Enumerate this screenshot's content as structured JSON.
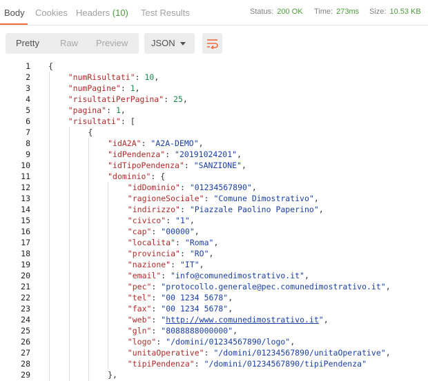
{
  "tabs": [
    {
      "label": "Body"
    },
    {
      "label": "Cookies"
    },
    {
      "label": "Headers",
      "count": "(10)"
    },
    {
      "label": "Test Results"
    }
  ],
  "response": {
    "status_label": "Status:",
    "status_value": "200 OK",
    "time_label": "Time:",
    "time_value": "273ms",
    "size_label": "Size:",
    "size_value": "10.53 KB"
  },
  "toolbar": {
    "views": [
      "Pretty",
      "Raw",
      "Preview"
    ],
    "format": "JSON",
    "wrap_icon": "wrap-lines-icon"
  },
  "colors": {
    "accent": "#f26b3a",
    "ok": "#4c9a3a",
    "key": "#b22a2a",
    "string": "#1a3ea8",
    "number": "#148b4a"
  },
  "code_lines": [
    {
      "n": "1",
      "indent": 0,
      "parts": [
        [
          "p",
          "{"
        ]
      ]
    },
    {
      "n": "2",
      "indent": 1,
      "parts": [
        [
          "k",
          "\"numRisultati\""
        ],
        [
          "p",
          ": "
        ],
        [
          "n",
          "10"
        ],
        [
          "p",
          ","
        ]
      ]
    },
    {
      "n": "3",
      "indent": 1,
      "parts": [
        [
          "k",
          "\"numPagine\""
        ],
        [
          "p",
          ": "
        ],
        [
          "n",
          "1"
        ],
        [
          "p",
          ","
        ]
      ]
    },
    {
      "n": "4",
      "indent": 1,
      "parts": [
        [
          "k",
          "\"risultatiPerPagina\""
        ],
        [
          "p",
          ": "
        ],
        [
          "n",
          "25"
        ],
        [
          "p",
          ","
        ]
      ]
    },
    {
      "n": "5",
      "indent": 1,
      "parts": [
        [
          "k",
          "\"pagina\""
        ],
        [
          "p",
          ": "
        ],
        [
          "n",
          "1"
        ],
        [
          "p",
          ","
        ]
      ]
    },
    {
      "n": "6",
      "indent": 1,
      "parts": [
        [
          "k",
          "\"risultati\""
        ],
        [
          "p",
          ": ["
        ]
      ]
    },
    {
      "n": "7",
      "indent": 2,
      "parts": [
        [
          "p",
          "{"
        ]
      ]
    },
    {
      "n": "8",
      "indent": 3,
      "parts": [
        [
          "k",
          "\"idA2A\""
        ],
        [
          "p",
          ": "
        ],
        [
          "s",
          "\"A2A-DEMO\""
        ],
        [
          "p",
          ","
        ]
      ]
    },
    {
      "n": "9",
      "indent": 3,
      "parts": [
        [
          "k",
          "\"idPendenza\""
        ],
        [
          "p",
          ": "
        ],
        [
          "s",
          "\"20191024201\""
        ],
        [
          "p",
          ","
        ]
      ]
    },
    {
      "n": "10",
      "indent": 3,
      "parts": [
        [
          "k",
          "\"idTipoPendenza\""
        ],
        [
          "p",
          ": "
        ],
        [
          "s",
          "\"SANZIONE\""
        ],
        [
          "p",
          ","
        ]
      ]
    },
    {
      "n": "11",
      "indent": 3,
      "parts": [
        [
          "k",
          "\"dominio\""
        ],
        [
          "p",
          ": {"
        ]
      ]
    },
    {
      "n": "12",
      "indent": 4,
      "parts": [
        [
          "k",
          "\"idDominio\""
        ],
        [
          "p",
          ": "
        ],
        [
          "s",
          "\"01234567890\""
        ],
        [
          "p",
          ","
        ]
      ]
    },
    {
      "n": "13",
      "indent": 4,
      "parts": [
        [
          "k",
          "\"ragioneSociale\""
        ],
        [
          "p",
          ": "
        ],
        [
          "s",
          "\"Comune Dimostrativo\""
        ],
        [
          "p",
          ","
        ]
      ]
    },
    {
      "n": "14",
      "indent": 4,
      "parts": [
        [
          "k",
          "\"indirizzo\""
        ],
        [
          "p",
          ": "
        ],
        [
          "s",
          "\"Piazzale Paolino Paperino\""
        ],
        [
          "p",
          ","
        ]
      ]
    },
    {
      "n": "15",
      "indent": 4,
      "parts": [
        [
          "k",
          "\"civico\""
        ],
        [
          "p",
          ": "
        ],
        [
          "s",
          "\"1\""
        ],
        [
          "p",
          ","
        ]
      ]
    },
    {
      "n": "16",
      "indent": 4,
      "parts": [
        [
          "k",
          "\"cap\""
        ],
        [
          "p",
          ": "
        ],
        [
          "s",
          "\"00000\""
        ],
        [
          "p",
          ","
        ]
      ]
    },
    {
      "n": "17",
      "indent": 4,
      "parts": [
        [
          "k",
          "\"localita\""
        ],
        [
          "p",
          ": "
        ],
        [
          "s",
          "\"Roma\""
        ],
        [
          "p",
          ","
        ]
      ]
    },
    {
      "n": "18",
      "indent": 4,
      "parts": [
        [
          "k",
          "\"provincia\""
        ],
        [
          "p",
          ": "
        ],
        [
          "s",
          "\"RO\""
        ],
        [
          "p",
          ","
        ]
      ]
    },
    {
      "n": "19",
      "indent": 4,
      "parts": [
        [
          "k",
          "\"nazione\""
        ],
        [
          "p",
          ": "
        ],
        [
          "s",
          "\"IT\""
        ],
        [
          "p",
          ","
        ]
      ]
    },
    {
      "n": "20",
      "indent": 4,
      "parts": [
        [
          "k",
          "\"email\""
        ],
        [
          "p",
          ": "
        ],
        [
          "s",
          "\"info@comunedimostrativo.it\""
        ],
        [
          "p",
          ","
        ]
      ]
    },
    {
      "n": "21",
      "indent": 4,
      "parts": [
        [
          "k",
          "\"pec\""
        ],
        [
          "p",
          ": "
        ],
        [
          "s",
          "\"protocollo.generale@pec.comunedimostrativo.it\""
        ],
        [
          "p",
          ","
        ]
      ]
    },
    {
      "n": "22",
      "indent": 4,
      "parts": [
        [
          "k",
          "\"tel\""
        ],
        [
          "p",
          ": "
        ],
        [
          "s",
          "\"00 1234 5678\""
        ],
        [
          "p",
          ","
        ]
      ]
    },
    {
      "n": "23",
      "indent": 4,
      "parts": [
        [
          "k",
          "\"fax\""
        ],
        [
          "p",
          ": "
        ],
        [
          "s",
          "\"00 1234 5678\""
        ],
        [
          "p",
          ","
        ]
      ]
    },
    {
      "n": "24",
      "indent": 4,
      "parts": [
        [
          "k",
          "\"web\""
        ],
        [
          "p",
          ": "
        ],
        [
          "s",
          "\""
        ],
        [
          "u",
          "http://www.comunedimostrativo.it"
        ],
        [
          "s",
          "\""
        ],
        [
          "p",
          ","
        ]
      ]
    },
    {
      "n": "25",
      "indent": 4,
      "parts": [
        [
          "k",
          "\"gln\""
        ],
        [
          "p",
          ": "
        ],
        [
          "s",
          "\"8088888000000\""
        ],
        [
          "p",
          ","
        ]
      ]
    },
    {
      "n": "26",
      "indent": 4,
      "parts": [
        [
          "k",
          "\"logo\""
        ],
        [
          "p",
          ": "
        ],
        [
          "s",
          "\"/domini/01234567890/logo\""
        ],
        [
          "p",
          ","
        ]
      ]
    },
    {
      "n": "27",
      "indent": 4,
      "parts": [
        [
          "k",
          "\"unitaOperative\""
        ],
        [
          "p",
          ": "
        ],
        [
          "s",
          "\"/domini/01234567890/unitaOperative\""
        ],
        [
          "p",
          ","
        ]
      ]
    },
    {
      "n": "28",
      "indent": 4,
      "parts": [
        [
          "k",
          "\"tipiPendenza\""
        ],
        [
          "p",
          ": "
        ],
        [
          "s",
          "\"/domini/01234567890/tipiPendenza\""
        ]
      ]
    },
    {
      "n": "29",
      "indent": 3,
      "parts": [
        [
          "p",
          "},"
        ]
      ]
    }
  ]
}
